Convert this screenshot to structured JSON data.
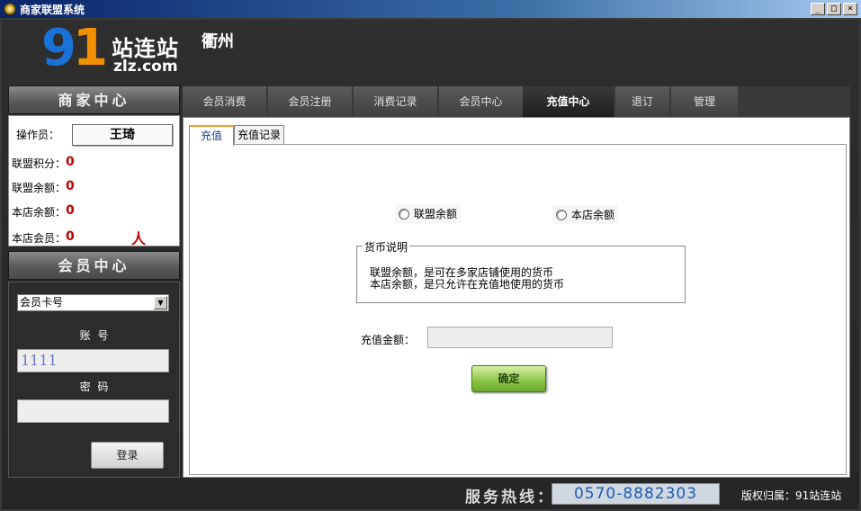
{
  "window": {
    "title": "商家联盟系统",
    "buttons": [
      "_",
      "□",
      "×"
    ]
  },
  "logo": {
    "digits": [
      "9",
      "1"
    ],
    "brand": "站连站",
    "domain": "zlz.com"
  },
  "city": "衢州",
  "merchant_panel": {
    "title": "商家中心",
    "operator_label": "操作员：",
    "operator_name": "王琦",
    "rows": [
      {
        "label": "联盟积分：",
        "value": "0"
      },
      {
        "label": "联盟余额：",
        "value": "0"
      },
      {
        "label": "本店余额：",
        "value": "0"
      },
      {
        "label": "本店会员：",
        "value": "0",
        "unit": "人"
      }
    ]
  },
  "member_panel": {
    "title": "会员中心",
    "card_type_selected": "会员卡号",
    "account_label": "账  号",
    "account_value": "1111",
    "password_label": "密  码",
    "password_value": "",
    "login_label": "登录"
  },
  "tabs": [
    {
      "label": "会员消费",
      "active": false
    },
    {
      "label": "会员注册",
      "active": false
    },
    {
      "label": "消费记录",
      "active": false
    },
    {
      "label": "会员中心",
      "active": false
    },
    {
      "label": "充值中心",
      "active": true
    },
    {
      "label": "退订",
      "active": false
    },
    {
      "label": "管理",
      "active": false
    }
  ],
  "subtabs": [
    {
      "label": "充值",
      "active": true
    },
    {
      "label": "充值记录",
      "active": false
    }
  ],
  "recharge": {
    "radio_options": [
      "联盟余额",
      "本店余额"
    ],
    "currency_legend": "货币说明",
    "currency_lines": [
      "联盟余额，是可在多家店铺使用的货币",
      "本店余额，是只允许在充值地使用的货币"
    ],
    "amount_label": "充值金额：",
    "amount_value": "",
    "confirm_label": "确定"
  },
  "footer": {
    "hotline_label": "服务热线：",
    "hotline_number": "0570-8882303",
    "copyright": "版权归属：91站连站"
  },
  "colors": {
    "accent_red": "#c00000",
    "logo_blue": "#1a72d8",
    "logo_orange": "#f29100",
    "confirm_green": "#8cc444"
  }
}
